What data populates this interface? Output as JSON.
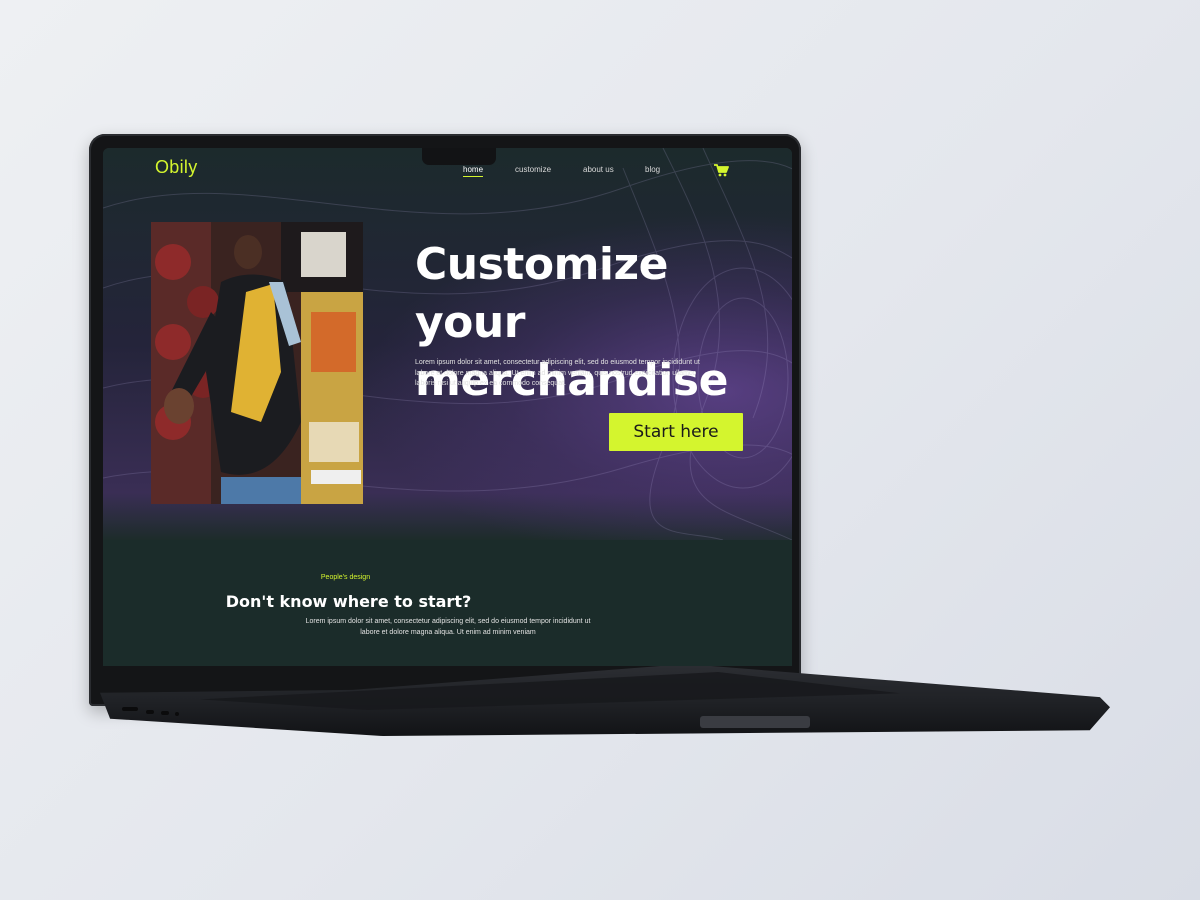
{
  "site": {
    "logo": "Obily",
    "nav": {
      "items": [
        "home",
        "customize",
        "about us",
        "blog"
      ],
      "active": "home"
    },
    "cart_icon": "shopping-cart-icon",
    "hero": {
      "title_line1": "Customize your",
      "title_line2": "merchandise",
      "text": "Lorem ipsum dolor sit amet, consectetur adipiscing elit, sed do eiusmod tempor incididunt ut labore et dolore magna aliqua. Ut enim ad minim veniam, quis nostrud exercitation ullamco laboris nisi ut aliquip ex ea commodo consequat.",
      "cta_label": "Start here"
    },
    "section": {
      "eyebrow": "People's design",
      "title": "Don't know where to start?",
      "text": "Lorem ipsum dolor sit amet, consectetur adipiscing elit, sed do eiusmod tempor incididunt ut labore et dolore magna aliqua. Ut enim ad minim veniam"
    }
  },
  "colors": {
    "accent": "#d4f52e",
    "hero_bg": "#24243a",
    "section_bg": "#1b2c2a",
    "purple_glow": "#664696"
  }
}
